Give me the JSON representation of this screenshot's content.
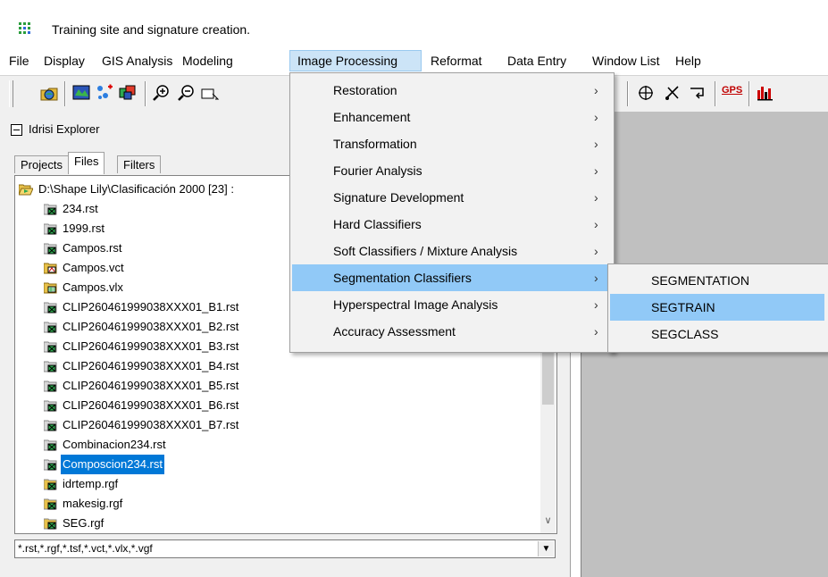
{
  "window": {
    "title": "Training site and signature creation."
  },
  "menubar": {
    "items": [
      {
        "label": "File"
      },
      {
        "label": "Display"
      },
      {
        "label": "GIS Analysis"
      },
      {
        "label": "Modeling"
      },
      {
        "label": "Image Processing"
      },
      {
        "label": "Reformat"
      },
      {
        "label": "Data Entry"
      },
      {
        "label": "Window List"
      },
      {
        "label": "Help"
      }
    ],
    "active": "Image Processing"
  },
  "toolbar": {
    "gps_label": "GPS",
    "icons": [
      "open-file-icon",
      "display-map-icon",
      "composite-icon",
      "layer-properties-icon",
      "zoom-in-icon",
      "zoom-out-icon",
      "zoom-window-icon",
      "crosshair-icon",
      "digitize-icon",
      "rubber-band-icon",
      "gps-icon",
      "histogram-icon"
    ]
  },
  "explorer": {
    "title": "Idrisi Explorer",
    "tabs": [
      {
        "label": "Projects"
      },
      {
        "label": "Files"
      },
      {
        "label": "Filters"
      }
    ],
    "selected_tab": "Files",
    "folder_path": "D:\\Shape Lily\\Clasificación 2000 [23] :",
    "files": [
      {
        "name": "234.rst",
        "type": "rst"
      },
      {
        "name": "1999.rst",
        "type": "rst"
      },
      {
        "name": "Campos.rst",
        "type": "rst"
      },
      {
        "name": "Campos.vct",
        "type": "vct"
      },
      {
        "name": "Campos.vlx",
        "type": "vlx"
      },
      {
        "name": "CLIP260461999038XXX01_B1.rst",
        "type": "rst"
      },
      {
        "name": "CLIP260461999038XXX01_B2.rst",
        "type": "rst"
      },
      {
        "name": "CLIP260461999038XXX01_B3.rst",
        "type": "rst"
      },
      {
        "name": "CLIP260461999038XXX01_B4.rst",
        "type": "rst"
      },
      {
        "name": "CLIP260461999038XXX01_B5.rst",
        "type": "rst"
      },
      {
        "name": "CLIP260461999038XXX01_B6.rst",
        "type": "rst"
      },
      {
        "name": "CLIP260461999038XXX01_B7.rst",
        "type": "rst"
      },
      {
        "name": "Combinacion234.rst",
        "type": "rst"
      },
      {
        "name": "Composcion234.rst",
        "type": "rst",
        "selected": true
      },
      {
        "name": "idrtemp.rgf",
        "type": "rgf"
      },
      {
        "name": "makesig.rgf",
        "type": "rgf"
      },
      {
        "name": "SEG.rgf",
        "type": "rgf"
      }
    ],
    "filter": "*.rst,*.rgf,*.tsf,*.vct,*.vlx,*.vgf"
  },
  "image_processing_menu": {
    "items": [
      {
        "label": "Restoration",
        "submenu": true
      },
      {
        "label": "Enhancement",
        "submenu": true
      },
      {
        "label": "Transformation",
        "submenu": true
      },
      {
        "label": "Fourier Analysis",
        "submenu": true
      },
      {
        "label": "Signature Development",
        "submenu": true
      },
      {
        "label": "Hard Classifiers",
        "submenu": true
      },
      {
        "label": "Soft Classifiers / Mixture Analysis",
        "submenu": true
      },
      {
        "label": "Segmentation Classifiers",
        "submenu": true,
        "highlighted": true
      },
      {
        "label": "Hyperspectral Image Analysis",
        "submenu": true
      },
      {
        "label": "Accuracy Assessment",
        "submenu": true
      }
    ]
  },
  "segmentation_menu": {
    "items": [
      {
        "label": "SEGMENTATION"
      },
      {
        "label": "SEGTRAIN",
        "highlighted": true
      },
      {
        "label": "SEGCLASS"
      }
    ]
  },
  "colors": {
    "menu_highlight": "#91c9f7",
    "selection": "#0078d7",
    "map_area": "#c0c0c0"
  }
}
